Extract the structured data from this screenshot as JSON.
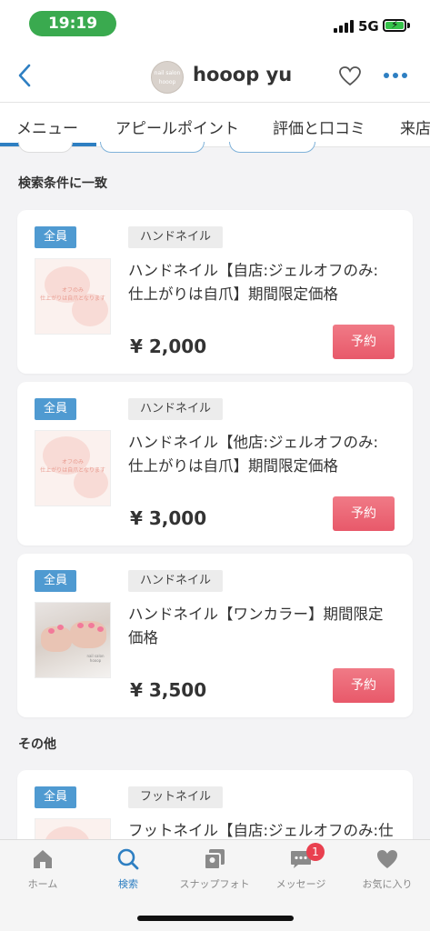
{
  "status_bar": {
    "time": "19:19",
    "network": "5G",
    "icons": [
      "signal-icon",
      "battery-charging-icon"
    ]
  },
  "header": {
    "shop_name": "hooop yu",
    "avatar_text": "nail salon hooop",
    "icons": [
      "back-chevron-icon",
      "heart-outline-icon",
      "more-dots-icon"
    ]
  },
  "tabs": [
    "メニュー",
    "アピールポイント",
    "評価と口コミ",
    "来店"
  ],
  "sections": {
    "match": "検索条件に一致",
    "other": "その他"
  },
  "cards": [
    {
      "badge": "全員",
      "category": "ハンドネイル",
      "title": "ハンドネイル【自店:ジェルオフのみ:仕上がりは自爪】期間限定価格",
      "thumb_text": "オフのみ\n仕上がりは自爪となります",
      "price": "¥ 2,000",
      "reserve": "予約"
    },
    {
      "badge": "全員",
      "category": "ハンドネイル",
      "title": "ハンドネイル【他店:ジェルオフのみ:仕上がりは自爪】期間限定価格",
      "thumb_text": "オフのみ\n仕上がりは自爪となります",
      "price": "¥ 3,000",
      "reserve": "予約"
    },
    {
      "badge": "全員",
      "category": "ハンドネイル",
      "title": "ハンドネイル【ワンカラー】期間限定価格",
      "thumb_text": "nail salon hooop",
      "price": "¥ 3,500",
      "reserve": "予約"
    },
    {
      "badge": "全員",
      "category": "フットネイル",
      "title": "フットネイル【自店:ジェルオフのみ:仕"
    }
  ],
  "bottom_nav": [
    {
      "label": "ホーム",
      "icon": "home-icon"
    },
    {
      "label": "検索",
      "icon": "search-icon"
    },
    {
      "label": "スナップフォト",
      "icon": "photo-stack-icon"
    },
    {
      "label": "メッセージ",
      "icon": "message-icon",
      "badge": "1"
    },
    {
      "label": "お気に入り",
      "icon": "heart-filled-icon"
    }
  ],
  "colors": {
    "accent": "#2e7fc2",
    "reserve": "#e8596a",
    "badge": "#4f9ad1",
    "time_pill": "#3aaa4f"
  }
}
